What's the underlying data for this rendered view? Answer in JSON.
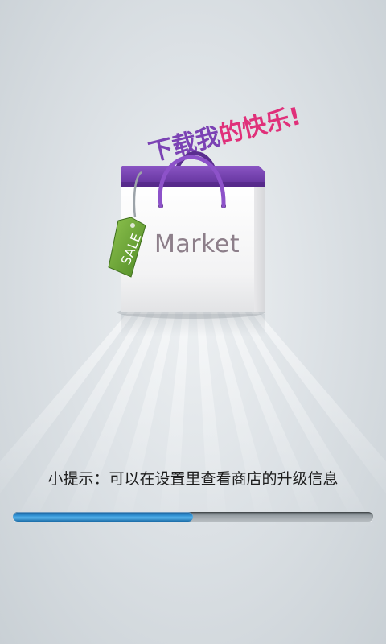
{
  "splash": {
    "slogan": "下载我的快乐!",
    "bag_label": "Market",
    "tag_text": "SALE"
  },
  "tip": {
    "text": "小提示：可以在设置里查看商店的升级信息"
  },
  "progress": {
    "fraction": 0.5
  },
  "colors": {
    "accent_purple": "#7b42b4",
    "slogan_pink": "#e0307a",
    "tag_green": "#6aa63a",
    "progress_blue": "#2f8ed0"
  }
}
